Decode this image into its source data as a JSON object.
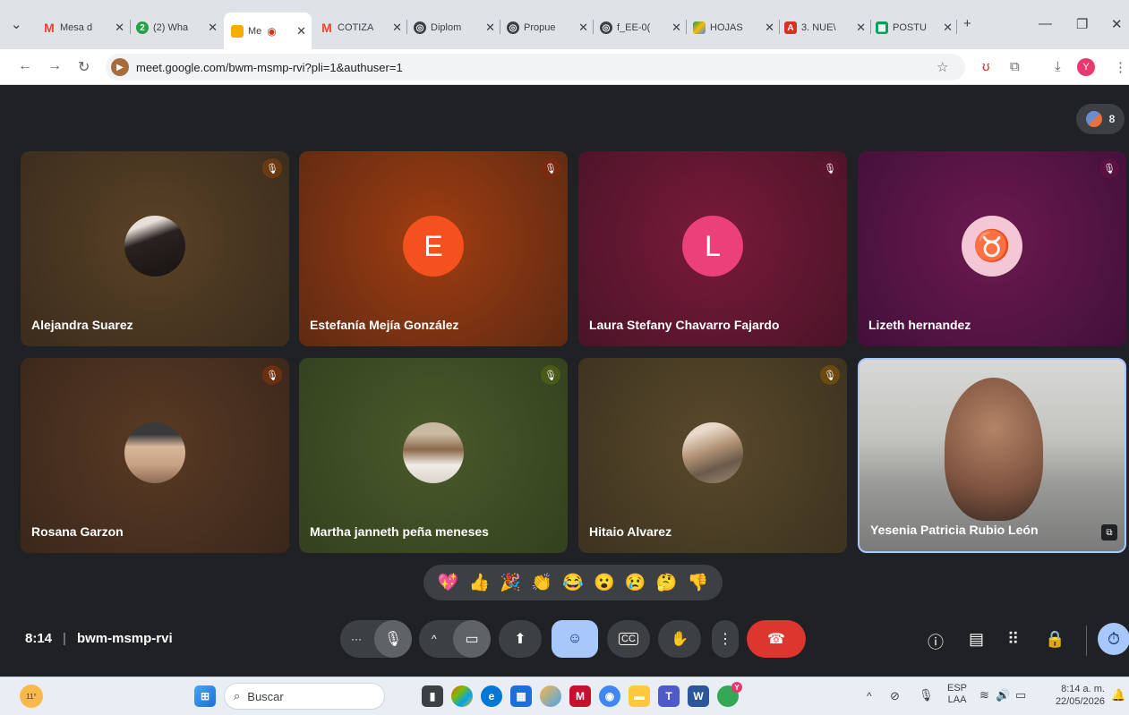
{
  "browser": {
    "tabs": [
      {
        "label": "Mesa d",
        "icon": "gmail-icon"
      },
      {
        "label": "(2) Wha",
        "icon": "whatsapp-icon"
      },
      {
        "label": "Me",
        "icon": "meet-icon",
        "active": true
      },
      {
        "label": "COTIZA",
        "icon": "gmail-icon"
      },
      {
        "label": "Diplom",
        "icon": "globe-icon"
      },
      {
        "label": "Propue",
        "icon": "globe-icon"
      },
      {
        "label": "f_EE-0(",
        "icon": "globe-icon"
      },
      {
        "label": "HOJAS",
        "icon": "drive-icon"
      },
      {
        "label": "3. NUE\\",
        "icon": "pdf-icon"
      },
      {
        "label": "POSTU",
        "icon": "sheets-icon"
      }
    ],
    "new_tab": "+",
    "url": "meet.google.com/bwm-msmp-rvi?pli=1&authuser=1",
    "profile_initial": "Y"
  },
  "meet": {
    "participant_count": "8",
    "participants": [
      {
        "name": "Alejandra Suarez",
        "avatar": "photo",
        "muted": true
      },
      {
        "name": "Estefanía Mejía González",
        "avatar": "letter",
        "letter": "E",
        "muted": true
      },
      {
        "name": "Laura Stefany Chavarro Fajardo",
        "avatar": "letter",
        "letter": "L",
        "muted": true
      },
      {
        "name": "Lizeth hernandez",
        "avatar": "taurus-icon",
        "muted": true
      },
      {
        "name": "Rosana Garzon",
        "avatar": "photo",
        "muted": true
      },
      {
        "name": "Martha janneth peña meneses",
        "avatar": "photo",
        "muted": true
      },
      {
        "name": "Hitaio Alvarez",
        "avatar": "photo",
        "muted": true
      },
      {
        "name": "Yesenia Patricia Rubio León",
        "avatar": "video",
        "muted": false
      }
    ],
    "reactions": [
      "💖",
      "👍",
      "🎉",
      "👏",
      "😂",
      "😮",
      "😢",
      "🤔",
      "👎"
    ],
    "time": "8:14",
    "meeting_code": "bwm-msmp-rvi"
  },
  "taskbar": {
    "weather": "11°",
    "search_placeholder": "Buscar",
    "lang_top": "ESP",
    "lang_bottom": "LAA",
    "clock_time": "8:14 a. m.",
    "clock_date": "22/05/2026",
    "chrome_badge": "Y"
  }
}
